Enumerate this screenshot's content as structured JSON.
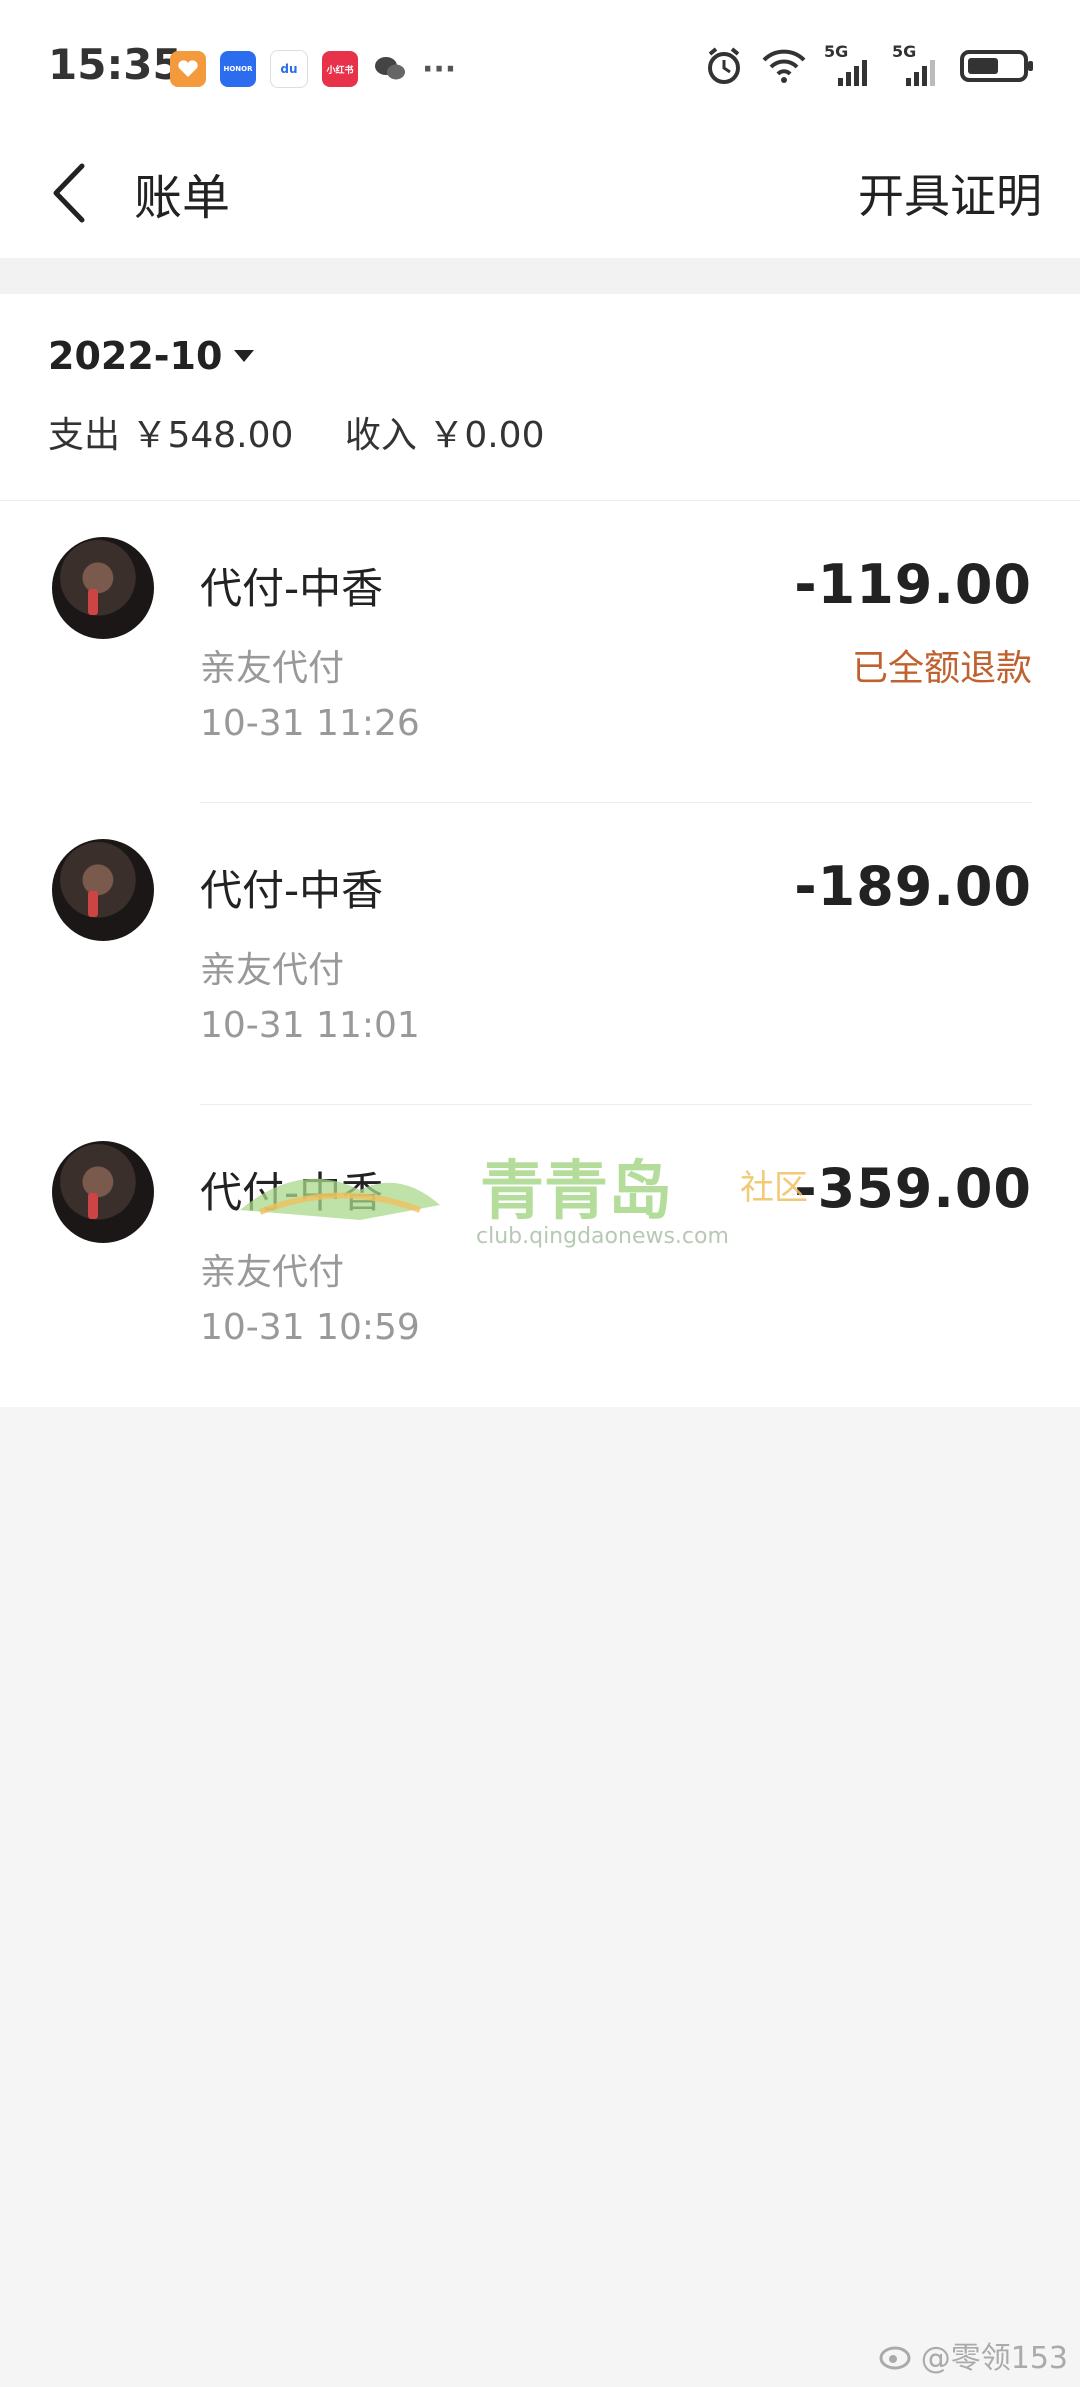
{
  "status_bar": {
    "time": "15:35",
    "apps": [
      {
        "icon": "heart-app-icon",
        "color": "#f39a3c",
        "label": ""
      },
      {
        "icon": "honor-app-icon",
        "color": "#2c6df0",
        "label": "HONOR"
      },
      {
        "icon": "baidu-app-icon",
        "color": "#ffffff",
        "label": "du"
      },
      {
        "icon": "xiaohongshu-app-icon",
        "color": "#e8324a",
        "label": "小红书"
      },
      {
        "icon": "wechat-icon",
        "color": "#ffffff",
        "label": ""
      }
    ],
    "more": "···",
    "network1": "5G",
    "network2": "5G"
  },
  "nav": {
    "title": "账单",
    "action": "开具证明"
  },
  "summary": {
    "month": "2022-10",
    "expense": "支出 ￥548.00",
    "income": "收入 ￥0.00"
  },
  "transactions": [
    {
      "title": "代付-中香",
      "type": "亲友代付",
      "time": "10-31  11:26",
      "amount": "-119.00",
      "status": "已全额退款"
    },
    {
      "title": "代付-中香",
      "type": "亲友代付",
      "time": "10-31  11:01",
      "amount": "-189.00",
      "status": ""
    },
    {
      "title": "代付-中香",
      "type": "亲友代付",
      "time": "10-31  10:59",
      "amount": "-359.00",
      "status": ""
    }
  ],
  "watermark": {
    "name": "青青岛",
    "suffix": "社区",
    "url": "club.qingdaonews.com"
  },
  "weibo_watermark": "@零领153",
  "colors": {
    "refund_status": "#c0622f",
    "background": "#f5f5f5"
  }
}
